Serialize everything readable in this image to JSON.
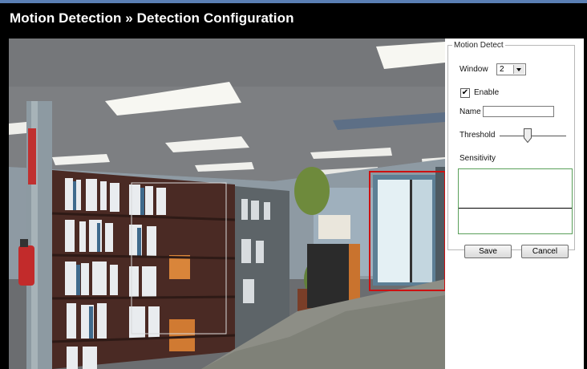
{
  "page": {
    "title": "Motion Detection » Detection Configuration"
  },
  "video": {
    "feed_icon": "live-camera-feed",
    "detection_window_colors": {
      "active": "#cc1111",
      "inactive": "#d8d8d8"
    }
  },
  "motion_detect": {
    "legend": "Motion Detect",
    "window_label": "Window",
    "window_value": "2",
    "enable_label": "Enable",
    "enable_checked": "✔",
    "name_label": "Name",
    "name_value": "",
    "threshold_label": "Threshold",
    "threshold_level": 0.42,
    "sensitivity_label": "Sensitivity",
    "save_label": "Save",
    "cancel_label": "Cancel"
  },
  "colors": {
    "header_bg": "#000000",
    "header_text": "#ffffff",
    "sensitivity_border": "#5aa05a"
  }
}
